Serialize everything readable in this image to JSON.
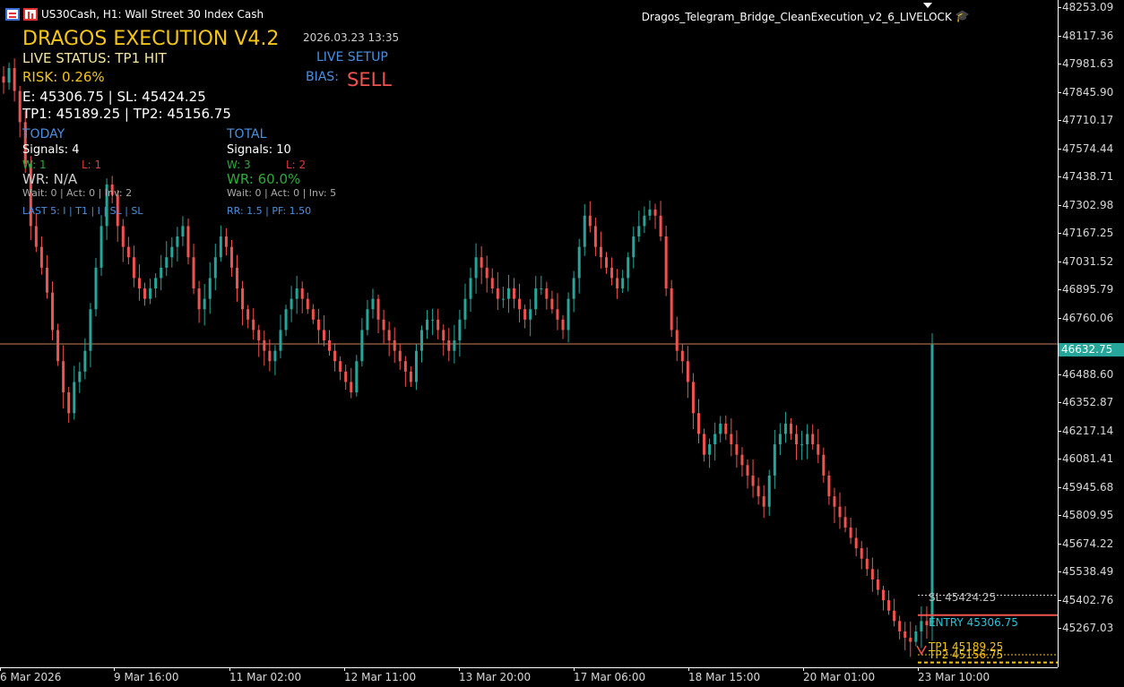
{
  "header": {
    "symbol_line": "US30Cash, H1:  Wall Street 30 Index Cash",
    "ea_name": "Dragos_Telegram_Bridge_CleanExecution_v2_6_LIVELOCK"
  },
  "panel": {
    "title": "DRAGOS EXECUTION V4.2",
    "timestamp": "2026.03.23 13:35",
    "live_status": "LIVE STATUS: TP1 HIT",
    "live_setup": "LIVE SETUP",
    "risk": "RISK: 0.26%",
    "bias_label": "BIAS:",
    "bias_value": "SELL",
    "entry_sl": "E: 45306.75  |  SL: 45424.25",
    "tp_line": "TP1: 45189.25  |  TP2: 45156.75",
    "today": {
      "heading": "TODAY",
      "signals": "Signals: 4",
      "wins": "W: 1",
      "losses": "L: 1",
      "wr": "WR: N/A",
      "wait": "Wait: 0 | Act: 0 | Inv: 2",
      "last5": "LAST 5: I | T1 | I | SL | SL"
    },
    "total": {
      "heading": "TOTAL",
      "signals": "Signals: 10",
      "wins": "W: 3",
      "losses": "L: 2",
      "wr": "WR: 60.0%",
      "wait": "Wait: 0 | Act: 0 | Inv: 5",
      "rr": "RR: 1.5 | PF: 1.50"
    }
  },
  "levels": {
    "sl_label": "SL 45424.25",
    "entry_label": "ENTRY 45306.75",
    "tp1_label": "TP1 45189.25",
    "tp2_label": "TP2 45156.75"
  },
  "price_axis": [
    "48253.09",
    "48117.36",
    "47981.63",
    "47845.90",
    "47710.17",
    "47574.44",
    "47438.71",
    "47302.98",
    "47167.25",
    "47031.52",
    "46895.79",
    "46760.06",
    "46488.60",
    "46352.87",
    "46217.14",
    "46081.41",
    "45945.68",
    "45809.95",
    "45674.22",
    "45538.49",
    "45402.76",
    "45267.03"
  ],
  "current_price": "46632.75",
  "time_axis": [
    "6 Mar 2026",
    "9 Mar 16:00",
    "11 Mar 02:00",
    "12 Mar 11:00",
    "13 Mar 20:00",
    "17 Mar 06:00",
    "18 Mar 15:00",
    "20 Mar 01:00",
    "23 Mar 10:00"
  ],
  "colors": {
    "bull": "#26a69a",
    "bear": "#ef5350",
    "title": "#f5c518",
    "blue": "#4a90e2",
    "green": "#2eaa3a",
    "red": "#e53935",
    "tp": "#f5c518",
    "price_line": "#c8825a"
  },
  "chart_data": {
    "type": "candlestick",
    "symbol": "US30Cash",
    "timeframe": "H1",
    "current_price": 46632.75,
    "ylim": [
      45170,
      48260
    ],
    "closes": [
      47890,
      47960,
      47850,
      47700,
      47500,
      47200,
      47100,
      47000,
      46880,
      46700,
      46550,
      46400,
      46300,
      46450,
      46500,
      46600,
      46800,
      47000,
      47200,
      47400,
      47350,
      47200,
      47100,
      47050,
      46950,
      46900,
      46850,
      46900,
      46950,
      47000,
      47050,
      47100,
      47150,
      47200,
      47050,
      46900,
      46800,
      46850,
      46950,
      47050,
      47150,
      47100,
      47000,
      46900,
      46800,
      46750,
      46700,
      46650,
      46600,
      46550,
      46600,
      46700,
      46800,
      46850,
      46900,
      46850,
      46800,
      46750,
      46700,
      46650,
      46600,
      46550,
      46500,
      46450,
      46400,
      46550,
      46700,
      46800,
      46850,
      46750,
      46700,
      46650,
      46600,
      46550,
      46500,
      46450,
      46600,
      46700,
      46750,
      46750,
      46700,
      46650,
      46600,
      46650,
      46750,
      46850,
      46950,
      47050,
      47000,
      46950,
      46900,
      46850,
      46850,
      46900,
      46850,
      46800,
      46750,
      46800,
      46900,
      46900,
      46850,
      46800,
      46750,
      46700,
      46850,
      46950,
      47100,
      47250,
      47200,
      47100,
      47050,
      47000,
      46950,
      46900,
      46950,
      47050,
      47150,
      47200,
      47250,
      47280,
      47250,
      47150,
      46900,
      46700,
      46600,
      46550,
      46450,
      46300,
      46200,
      46100,
      46150,
      46200,
      46250,
      46200,
      46150,
      46100,
      46050,
      46000,
      45950,
      45900,
      45850,
      46000,
      46150,
      46200,
      46250,
      46200,
      46150,
      46150,
      46200,
      46150,
      46100,
      46000,
      45900,
      45850,
      45800,
      45750,
      45700,
      45650,
      45600,
      45550,
      45500,
      45450,
      45400,
      45350,
      45300,
      45250,
      45220,
      45200,
      45250,
      45300,
      45280,
      46630
    ]
  }
}
